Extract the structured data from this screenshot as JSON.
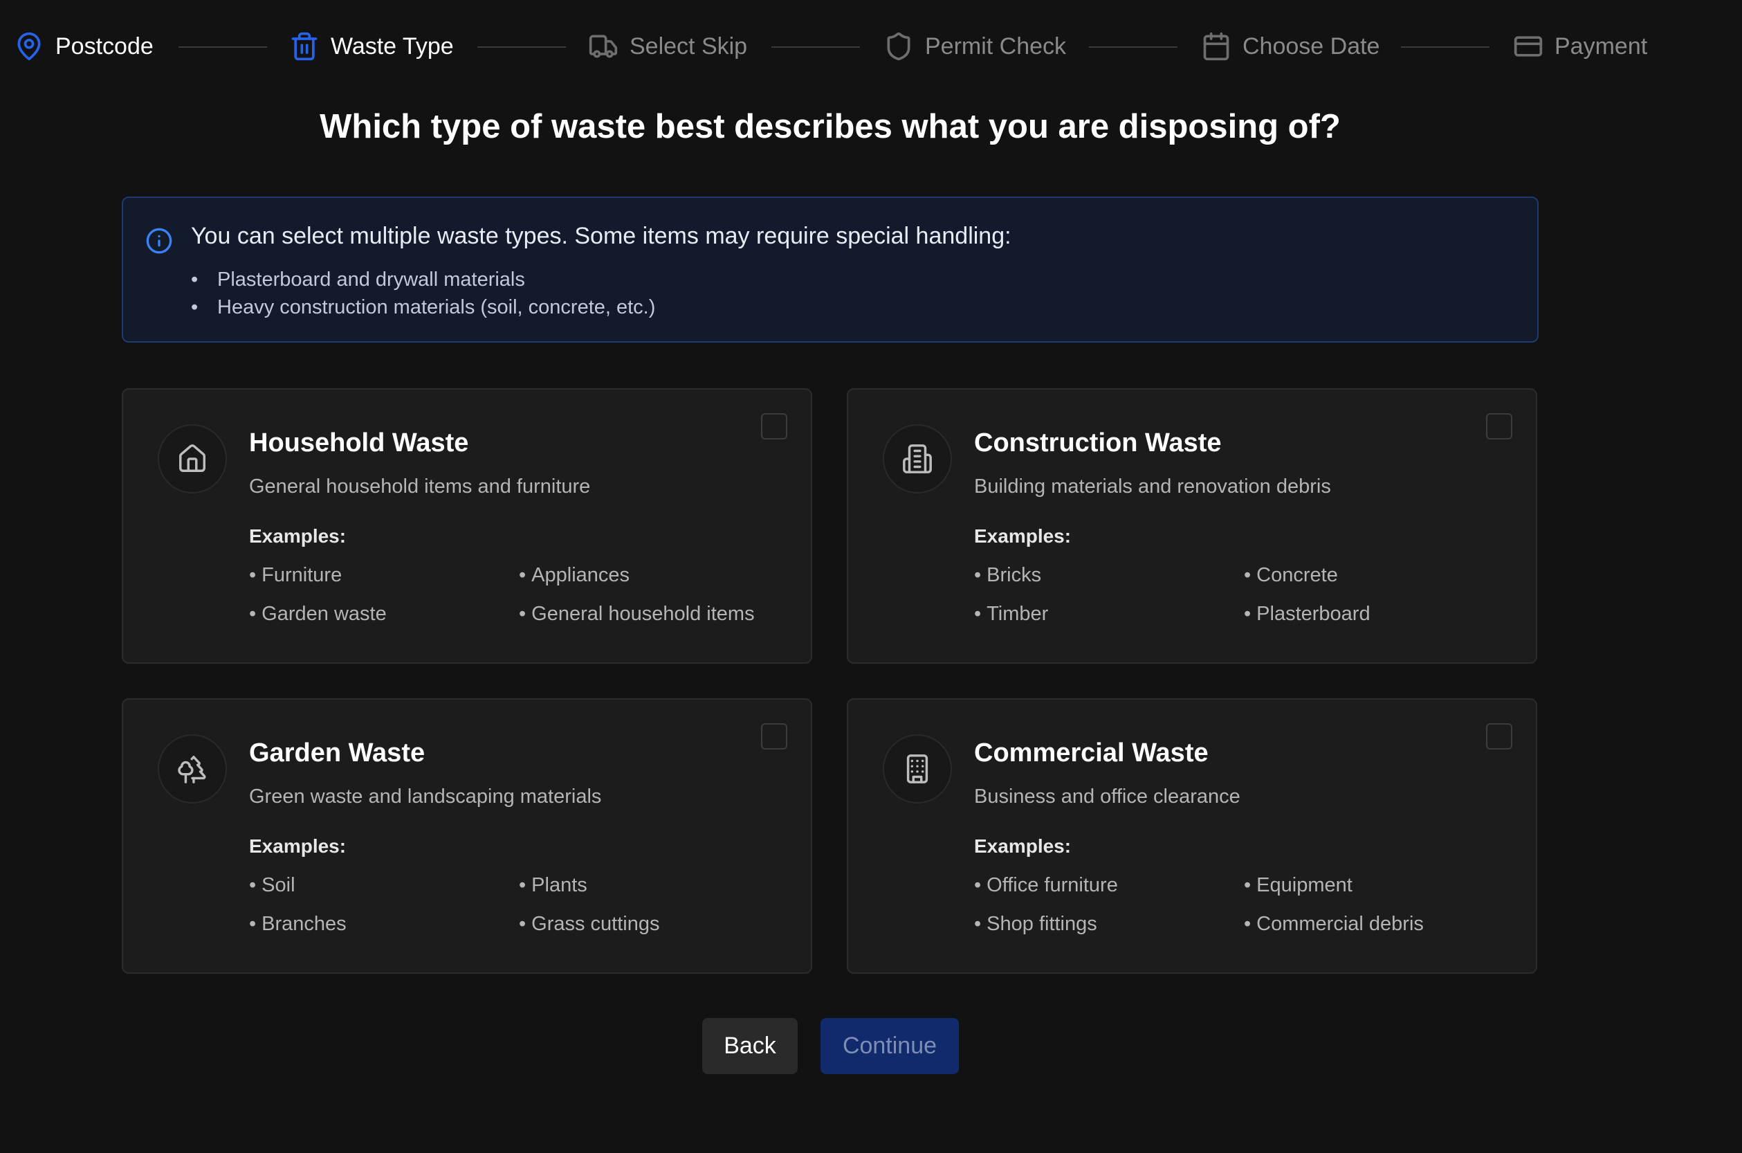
{
  "stepper": {
    "steps": [
      {
        "label": "Postcode",
        "icon": "map-pin-icon",
        "state": "done"
      },
      {
        "label": "Waste Type",
        "icon": "trash-icon",
        "state": "active"
      },
      {
        "label": "Select Skip",
        "icon": "truck-icon",
        "state": "todo"
      },
      {
        "label": "Permit Check",
        "icon": "shield-icon",
        "state": "todo"
      },
      {
        "label": "Choose Date",
        "icon": "calendar-icon",
        "state": "todo"
      },
      {
        "label": "Payment",
        "icon": "credit-card-icon",
        "state": "todo"
      }
    ]
  },
  "heading": "Which type of waste best describes what you are disposing of?",
  "info": {
    "icon": "info-icon",
    "title": "You can select multiple waste types. Some items may require special handling:",
    "items": [
      "Plasterboard and drywall materials",
      "Heavy construction materials (soil, concrete, etc.)"
    ]
  },
  "examples_label": "Examples:",
  "bullet": "•",
  "cards": [
    {
      "icon": "home-icon",
      "title": "Household Waste",
      "description": "General household items and furniture",
      "examples": [
        "Furniture",
        "Appliances",
        "Garden waste",
        "General household items"
      ],
      "checked": false
    },
    {
      "icon": "building-icon",
      "title": "Construction Waste",
      "description": "Building materials and renovation debris",
      "examples": [
        "Bricks",
        "Concrete",
        "Timber",
        "Plasterboard"
      ],
      "checked": false
    },
    {
      "icon": "trees-icon",
      "title": "Garden Waste",
      "description": "Green waste and landscaping materials",
      "examples": [
        "Soil",
        "Plants",
        "Branches",
        "Grass cuttings"
      ],
      "checked": false
    },
    {
      "icon": "office-building-icon",
      "title": "Commercial Waste",
      "description": "Business and office clearance",
      "examples": [
        "Office furniture",
        "Equipment",
        "Shop fittings",
        "Commercial debris"
      ],
      "checked": false
    }
  ],
  "buttons": {
    "back": "Back",
    "continue": "Continue"
  },
  "colors": {
    "accent": "#2563eb",
    "background": "#121212",
    "card": "#1c1c1c",
    "info_bg": "#131a2c",
    "continue_disabled": "#102a6b"
  }
}
